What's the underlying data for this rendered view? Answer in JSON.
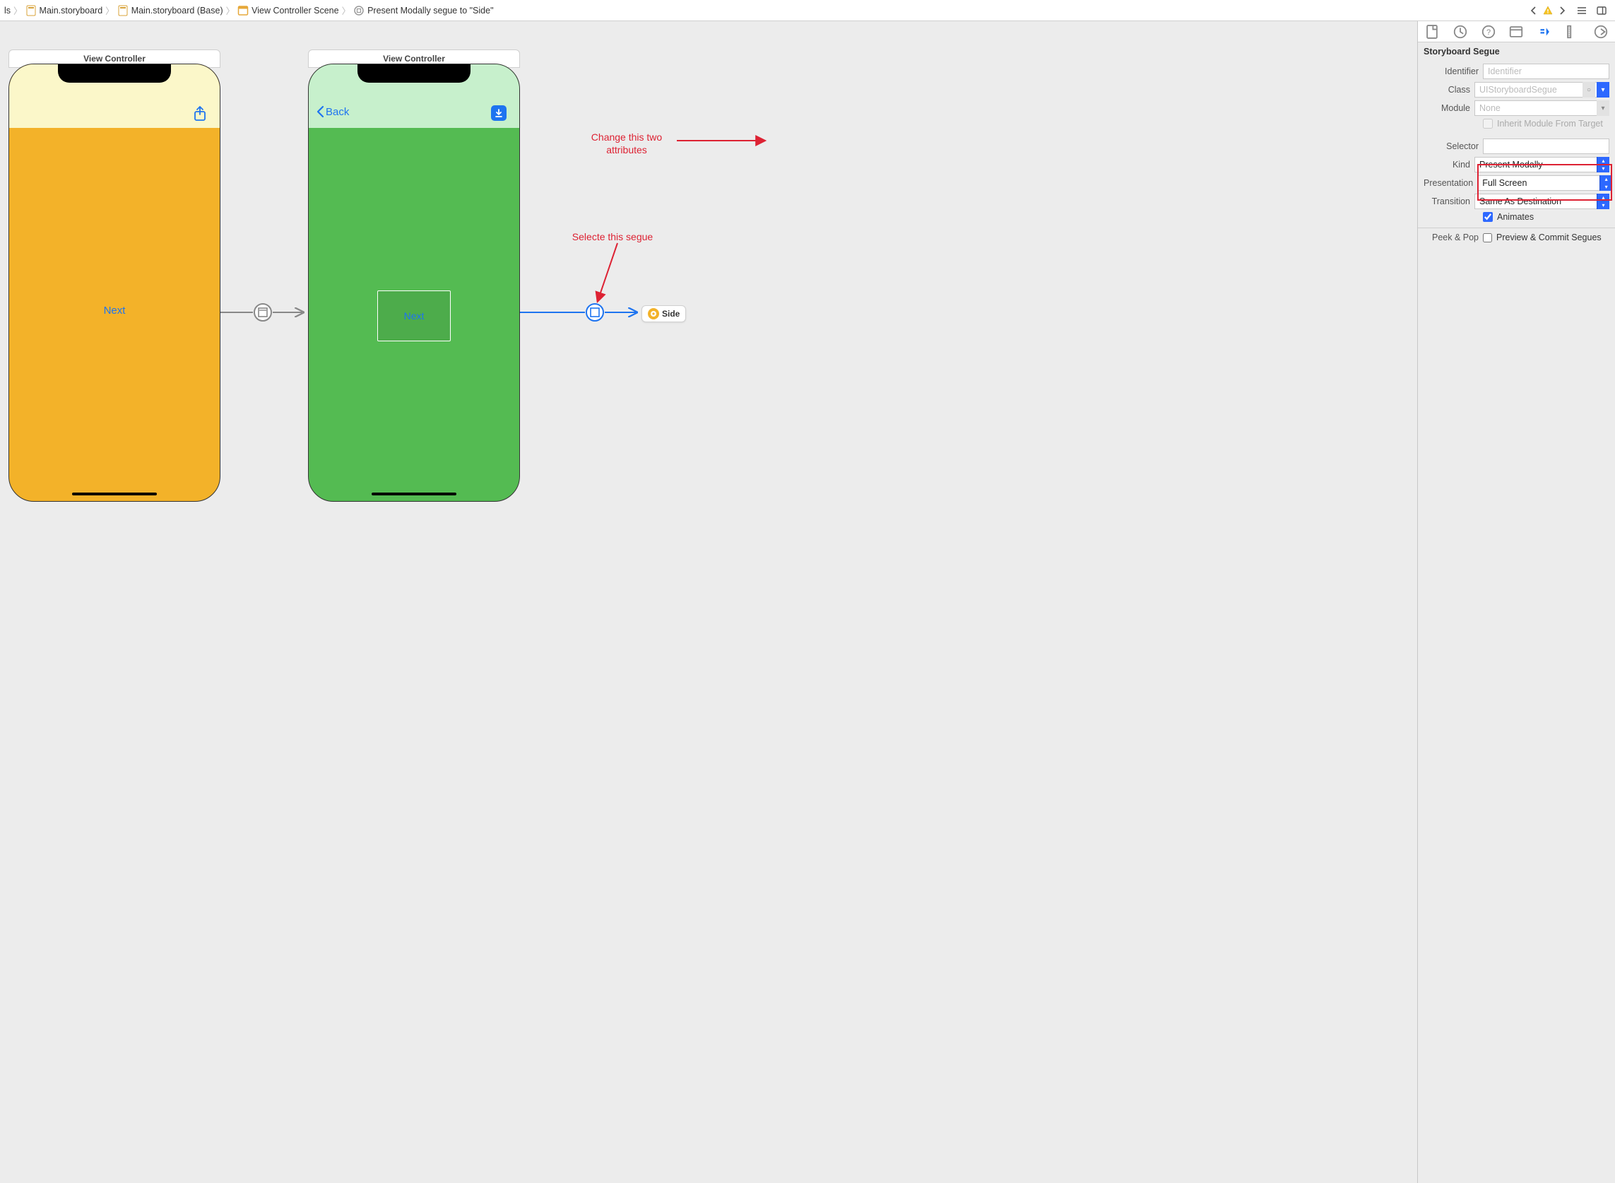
{
  "breadcrumbs": {
    "b0": "ls",
    "b1": "Main.storyboard",
    "b2": "Main.storyboard (Base)",
    "b3": "View Controller Scene",
    "b4": "Present Modally segue to \"Side\""
  },
  "scenes": {
    "scene1_title": "View Controller",
    "scene1_next": "Next",
    "scene2_title": "View Controller",
    "scene2_back": "Back",
    "scene2_next": "Next",
    "side_ref": "Side"
  },
  "annotations": {
    "attrs_line1": "Change this two",
    "attrs_line2": "attributes",
    "segue": "Selecte this segue"
  },
  "inspector": {
    "title": "Storyboard Segue",
    "labels": {
      "identifier": "Identifier",
      "class": "Class",
      "module": "Module",
      "inherit": "Inherit Module From Target",
      "selector": "Selector",
      "kind": "Kind",
      "presentation": "Presentation",
      "transition": "Transition",
      "animates": "Animates",
      "peekpop": "Peek & Pop",
      "preview": "Preview & Commit Segues"
    },
    "values": {
      "identifier_ph": "Identifier",
      "class_ph": "UIStoryboardSegue",
      "module_ph": "None",
      "kind": "Present Modally",
      "presentation": "Full Screen",
      "transition": "Same As Destination"
    }
  }
}
